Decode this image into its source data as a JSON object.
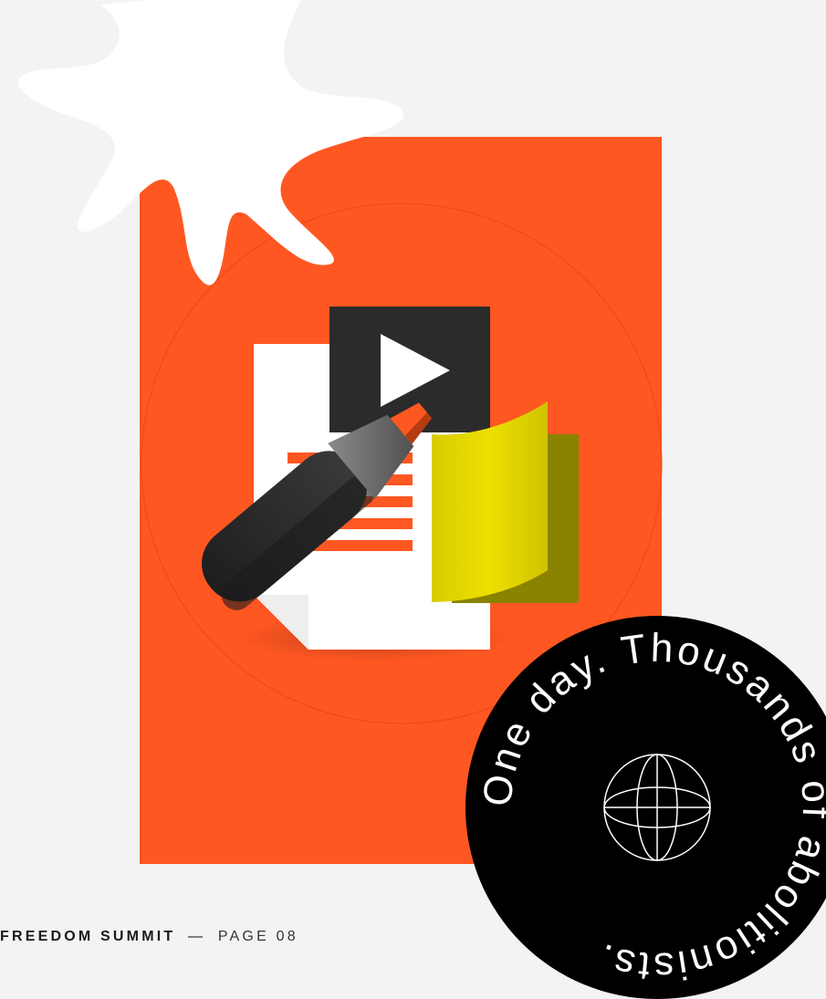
{
  "footer": {
    "brand": "FREEDOM SUMMIT",
    "separator": "—",
    "page_label": "PAGE 08"
  },
  "badge": {
    "ring_text": "One day. Thousands of abolitionists.",
    "icon": "globe-icon"
  },
  "illustration": {
    "icons": [
      "starburst-shape",
      "document-icon",
      "video-play-icon",
      "highlighter-icon",
      "sticky-note-icon"
    ]
  },
  "colors": {
    "background": "#f3f3f3",
    "accent": "#ff5722",
    "dark": "#2b2b2b",
    "sticky": "#e8dc00",
    "badge": "#000000"
  }
}
